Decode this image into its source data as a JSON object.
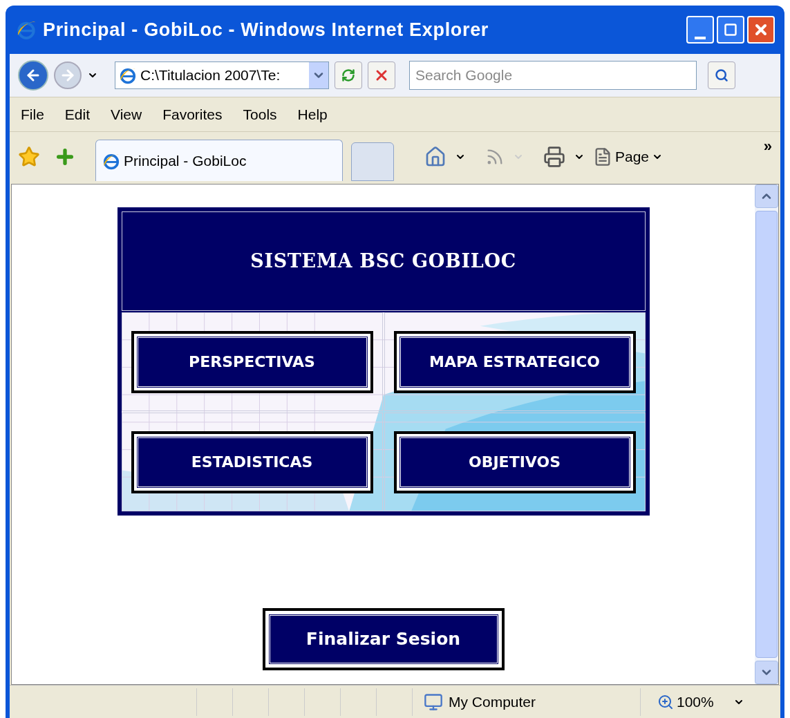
{
  "window": {
    "title": "Principal - GobiLoc - Windows Internet Explorer"
  },
  "address_bar": {
    "value": "C:\\Titulacion 2007\\Te:"
  },
  "search": {
    "placeholder": "Search Google"
  },
  "menu": [
    "File",
    "Edit",
    "View",
    "Favorites",
    "Tools",
    "Help"
  ],
  "tabs": [
    {
      "label": "Principal - GobiLoc",
      "selected": true
    }
  ],
  "command_bar": {
    "page": "Page",
    "more": "»"
  },
  "page": {
    "heading": "SISTEMA BSC GOBILOC",
    "buttons": [
      {
        "label": "PERSPECTIVAS"
      },
      {
        "label": "MAPA ESTRATEGICO"
      },
      {
        "label": "ESTADISTICAS"
      },
      {
        "label": "OBJETIVOS"
      }
    ],
    "logout": "Finalizar Sesion"
  },
  "status_bar": {
    "zone": "My Computer",
    "zoom": "100%"
  }
}
